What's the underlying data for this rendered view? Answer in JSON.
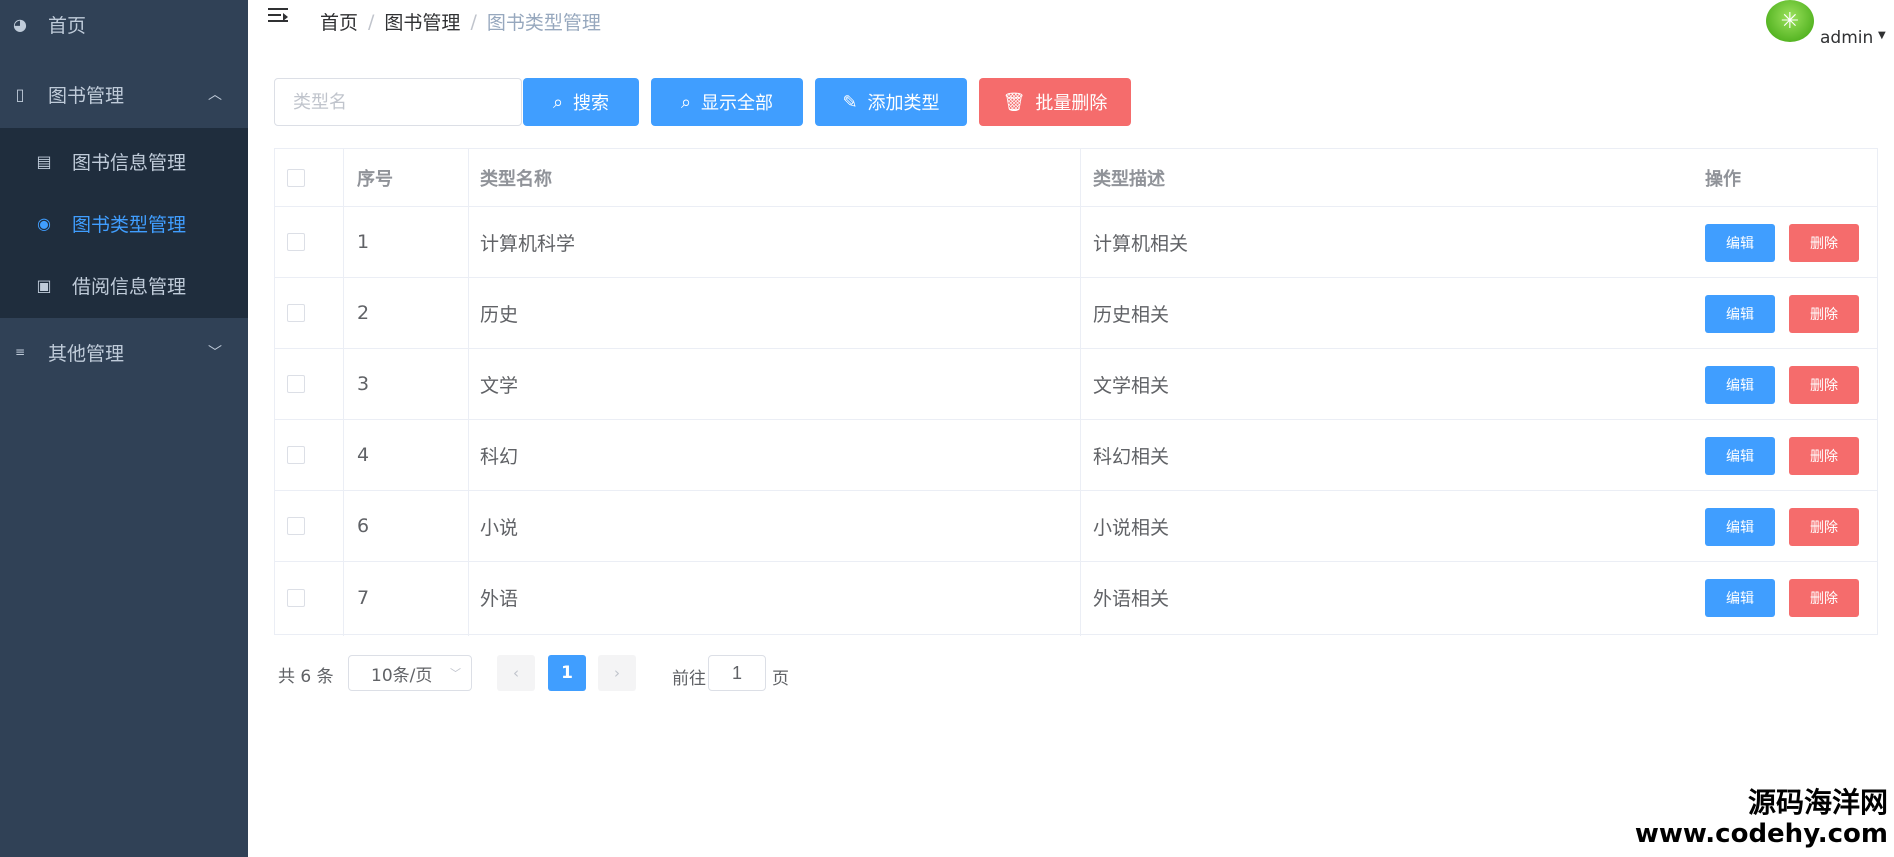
{
  "sidebar": {
    "home": "首页",
    "book_mgmt": "图书管理",
    "book_info": "图书信息管理",
    "book_type": "图书类型管理",
    "borrow_info": "借阅信息管理",
    "other_mgmt": "其他管理"
  },
  "breadcrumb": {
    "home": "首页",
    "book_mgmt": "图书管理",
    "current": "图书类型管理",
    "sep": "/"
  },
  "user": {
    "name": "admin"
  },
  "toolbar": {
    "search_placeholder": "类型名",
    "search_label": "搜索",
    "show_all_label": "显示全部",
    "add_label": "添加类型",
    "batch_delete_label": "批量删除"
  },
  "table": {
    "headers": {
      "index": "序号",
      "name": "类型名称",
      "desc": "类型描述",
      "actions": "操作"
    },
    "edit_label": "编辑",
    "delete_label": "删除",
    "rows": [
      {
        "id": "1",
        "name": "计算机科学",
        "desc": "计算机相关"
      },
      {
        "id": "2",
        "name": "历史",
        "desc": "历史相关"
      },
      {
        "id": "3",
        "name": "文学",
        "desc": "文学相关"
      },
      {
        "id": "4",
        "name": "科幻",
        "desc": "科幻相关"
      },
      {
        "id": "6",
        "name": "小说",
        "desc": "小说相关"
      },
      {
        "id": "7",
        "name": "外语",
        "desc": "外语相关"
      }
    ]
  },
  "pagination": {
    "total": "共 6 条",
    "page_size": "10条/页",
    "current_page": "1",
    "goto_label": "前往",
    "goto_value": "1",
    "page_suffix": "页"
  },
  "watermark": {
    "line1": "源码海洋网",
    "line2": "www.codehy.com"
  },
  "colors": {
    "primary": "#409eff",
    "danger": "#f56c6c",
    "sidebar_bg": "#304156",
    "submenu_bg": "#1f2d3d"
  }
}
